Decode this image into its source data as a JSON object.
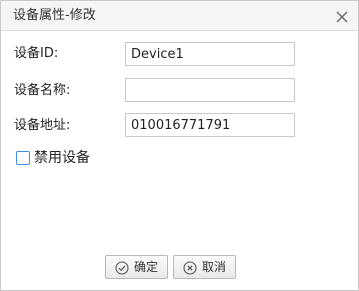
{
  "dialog": {
    "title": "设备属性-修改"
  },
  "form": {
    "device_id": {
      "label": "设备ID:",
      "value": "Device1"
    },
    "device_name": {
      "label": "设备名称:",
      "value": ""
    },
    "device_address": {
      "label": "设备地址:",
      "value": "010016771791"
    },
    "disable_device": {
      "label": "禁用设备",
      "checked": false
    }
  },
  "buttons": {
    "confirm": {
      "label": "确定",
      "icon": "check-circle-icon"
    },
    "cancel": {
      "label": "取消",
      "icon": "x-circle-icon"
    }
  },
  "colors": {
    "accent": "#3a8ee6",
    "border": "#c9c9c9",
    "titlebar": "#f5f5f5"
  }
}
